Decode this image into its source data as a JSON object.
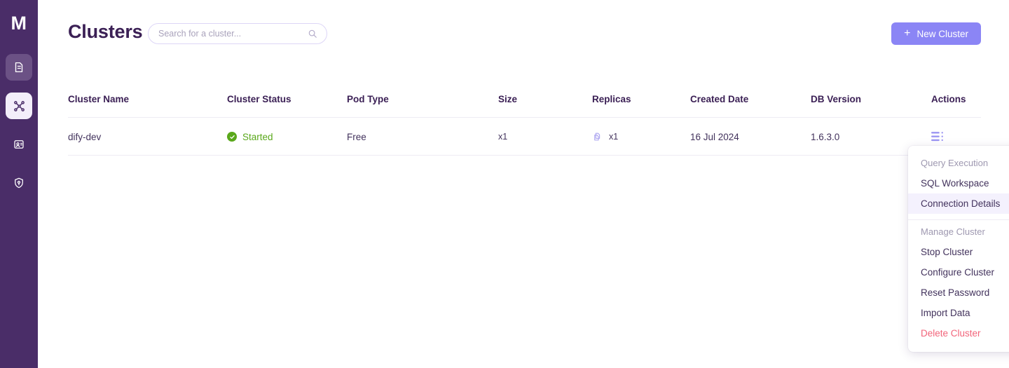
{
  "sidebar": {
    "logo": "M",
    "items": [
      {
        "name": "database-icon",
        "state": "semi"
      },
      {
        "name": "clusters-icon",
        "state": "active"
      },
      {
        "name": "account-icon",
        "state": "plain"
      },
      {
        "name": "security-icon",
        "state": "plain"
      }
    ]
  },
  "header": {
    "title": "Clusters",
    "search_placeholder": "Search for a cluster...",
    "search_value": "",
    "search_icon": "search-icon",
    "new_cluster_label": "New Cluster",
    "plus_icon": "+"
  },
  "table": {
    "columns": [
      "Cluster Name",
      "Cluster Status",
      "Pod Type",
      "Size",
      "Replicas",
      "Created Date",
      "DB Version",
      "Actions"
    ],
    "rows": [
      {
        "cluster_name": "dify-dev",
        "status": "Started",
        "status_icon": "check-circle-icon",
        "pod_type": "Free",
        "size": "x1",
        "replicas": "x1",
        "replicas_icon": "copies-icon",
        "created_date": "16 Jul 2024",
        "db_version": "1.6.3.0",
        "actions_icon": "list-actions-icon"
      }
    ]
  },
  "dropdown": {
    "sections": [
      {
        "label": "Query Execution",
        "items": [
          {
            "label": "SQL Workspace",
            "highlighted": false,
            "danger": false
          },
          {
            "label": "Connection Details",
            "highlighted": true,
            "danger": false
          }
        ]
      },
      {
        "label": "Manage Cluster",
        "items": [
          {
            "label": "Stop Cluster",
            "highlighted": false,
            "danger": false
          },
          {
            "label": "Configure Cluster",
            "highlighted": false,
            "danger": false
          },
          {
            "label": "Reset Password",
            "highlighted": false,
            "danger": false
          },
          {
            "label": "Import Data",
            "highlighted": false,
            "danger": false
          },
          {
            "label": "Delete Cluster",
            "highlighted": false,
            "danger": true
          }
        ]
      }
    ]
  },
  "colors": {
    "sidebar_bg": "#4a2d68",
    "accent": "#8b85f5",
    "title": "#3b2055",
    "status_green": "#5aa81b",
    "danger": "#f2647a",
    "border": "#eeecf4",
    "muted": "#9e98b0"
  }
}
